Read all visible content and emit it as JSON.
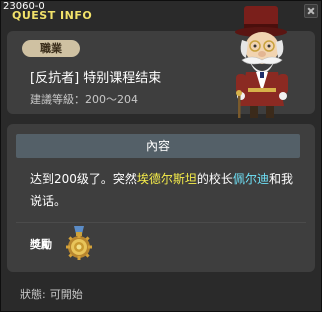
{
  "window": {
    "id": "23060-0",
    "title": "QUEST INFO"
  },
  "quest": {
    "job_badge": "職業",
    "name": "[反抗者] 特别课程结束",
    "level_hint": "建議等級：200～204"
  },
  "content": {
    "header": "內容",
    "desc_part1": "达到200级了。突然",
    "desc_name1": "埃德尔斯坦",
    "desc_part2": "的校长",
    "desc_name2": "佩尔迪",
    "desc_part3": "和我说话。"
  },
  "reward": {
    "label": "獎勵",
    "icon": "medal-icon"
  },
  "status": {
    "label": "狀態:",
    "value": "可開始"
  },
  "colors": {
    "title": "#f2e26a",
    "badge": "#cfc1a2",
    "highlight_yellow": "#f7ee4a",
    "highlight_cyan": "#6fe1f7"
  }
}
